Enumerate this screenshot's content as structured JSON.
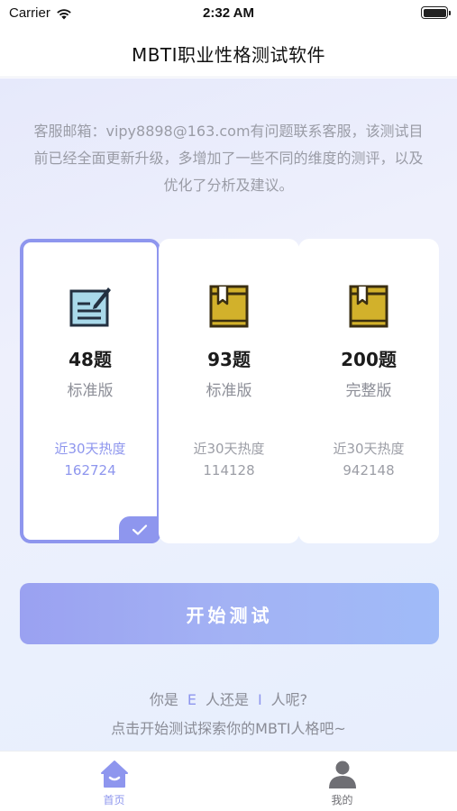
{
  "status_bar": {
    "carrier": "Carrier",
    "time": "2:32 AM"
  },
  "nav": {
    "title": "MBTI职业性格测试软件"
  },
  "notice": "客服邮箱：vipy8898@163.com有问题联系客服，该测试目前已经全面更新升级，多增加了一些不同的维度的测评，以及优化了分析及建议。",
  "cards": [
    {
      "count": "48题",
      "edition": "标准版",
      "heat_label": "近30天热度",
      "heat_value": "162724",
      "selected": true,
      "icon": "edit-note-icon"
    },
    {
      "count": "93题",
      "edition": "标准版",
      "heat_label": "近30天热度",
      "heat_value": "114128",
      "selected": false,
      "icon": "book-icon"
    },
    {
      "count": "200题",
      "edition": "完整版",
      "heat_label": "近30天热度",
      "heat_value": "942148",
      "selected": false,
      "icon": "book-icon"
    }
  ],
  "start_button": {
    "label": "开始测试"
  },
  "question": {
    "part1": "你是",
    "letter_e": "E",
    "part2": "人还是",
    "letter_i": "I",
    "part3": "人呢?"
  },
  "prompt": "点击开始测试探索你的MBTI人格吧~",
  "tabs": [
    {
      "label": "首页",
      "icon": "home-icon",
      "active": true
    },
    {
      "label": "我的",
      "icon": "user-icon",
      "active": false
    }
  ],
  "colors": {
    "accent": "#8e96ee",
    "book_gold": "#d2b12b",
    "book_dark": "#3a2e10",
    "edit_blue": "#a9d9ea",
    "edit_dark": "#233040"
  }
}
